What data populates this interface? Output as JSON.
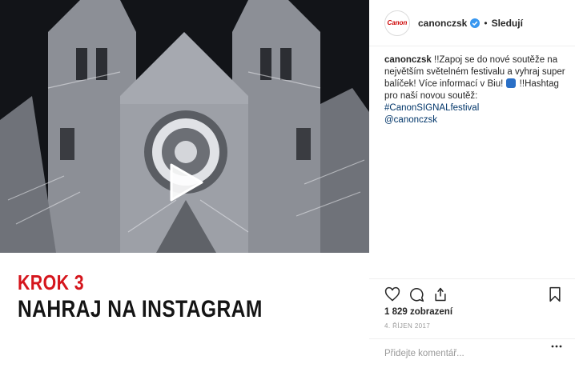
{
  "post": {
    "username": "canonczsk",
    "follow_label": "Sledují",
    "separator": "•",
    "avatar_text": "Canon",
    "caption_user": "canonczsk",
    "caption_text_1": " !!Zapoj se do nové soutěže na největším světelném festivalu a vyhraj super balíček! Více informací v Biu! ",
    "caption_text_2": " !!Hashtag pro naší novou soutěž: ",
    "hashtag": "#CanonSIGNALfestival",
    "mention": "@canonczsk",
    "views": "1 829 zobrazení",
    "date": "4. ŘÍJEN 2017",
    "comment_placeholder": "Přidejte komentář...",
    "more_label": "•••"
  },
  "card": {
    "step": "KROK 3",
    "instruction": "NAHRAJ NA INSTAGRAM"
  },
  "icons": {
    "heart": "heart-icon",
    "comment": "comment-icon",
    "share": "share-icon",
    "bookmark": "bookmark-icon",
    "play": "play-icon",
    "verified": "verified-badge-icon"
  },
  "colors": {
    "brand_red": "#d5151c",
    "link": "#003569",
    "verified": "#3897f0"
  }
}
